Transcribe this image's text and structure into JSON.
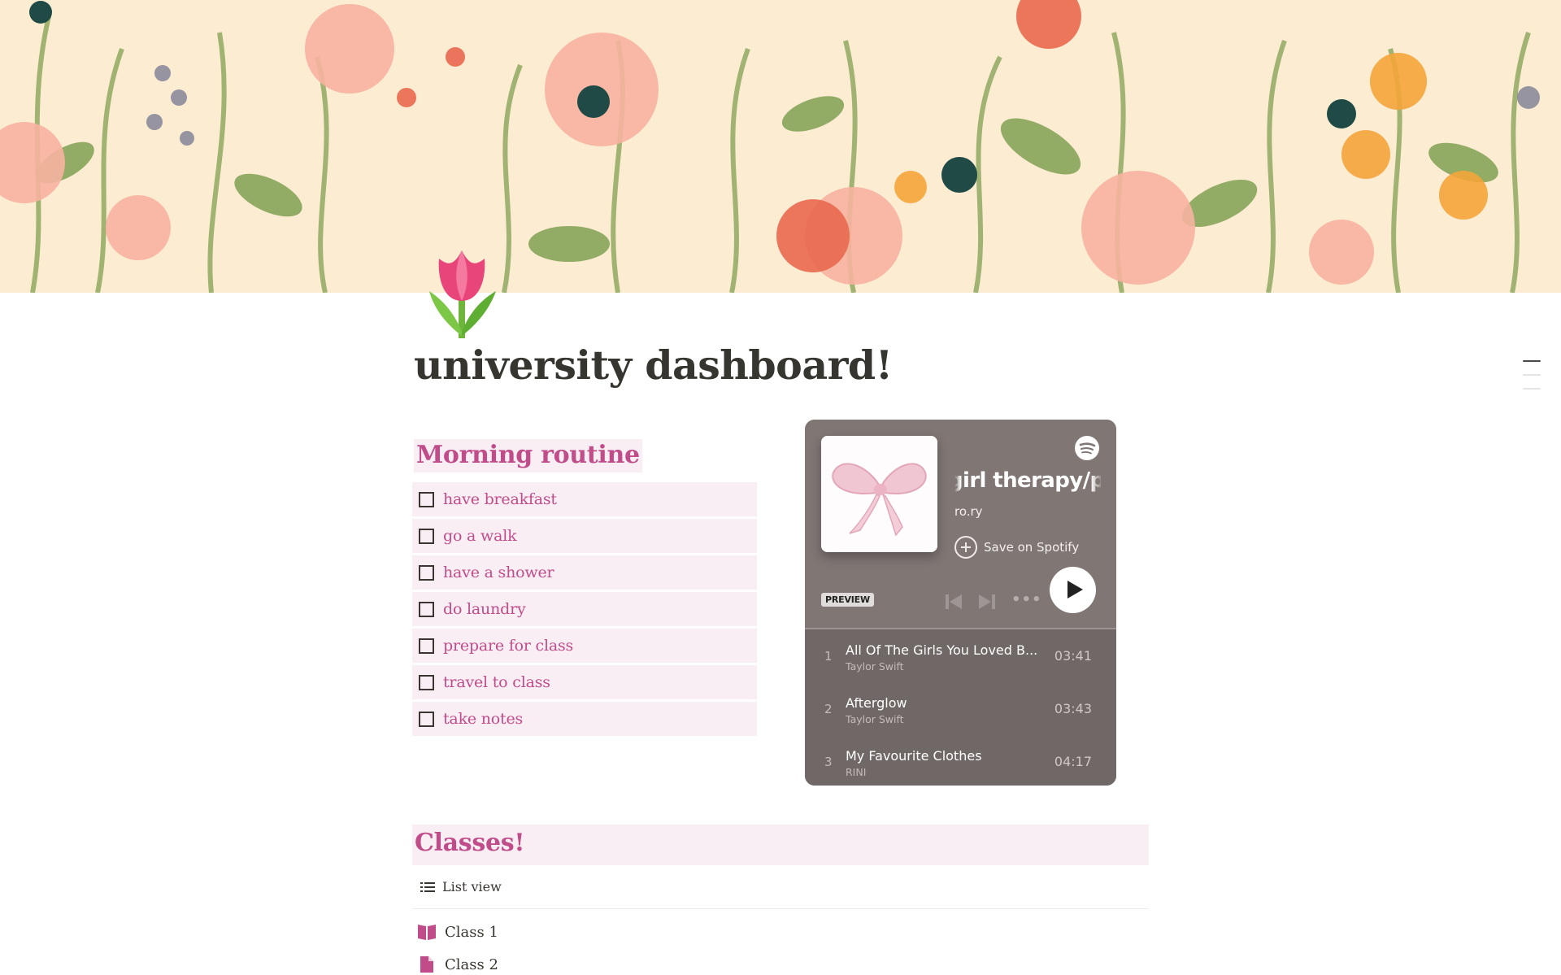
{
  "page": {
    "title": "university dashboard!",
    "icon": "tulip-emoji",
    "cover": "watercolor-wildflowers-cover"
  },
  "toc": {
    "items": [
      "heading-1",
      "heading-2",
      "heading-3"
    ],
    "active_index": 0
  },
  "morning_routine": {
    "heading": "Morning routine",
    "items": [
      {
        "label": "have breakfast",
        "checked": false
      },
      {
        "label": "go a walk",
        "checked": false
      },
      {
        "label": "have a shower",
        "checked": false
      },
      {
        "label": "do laundry",
        "checked": false
      },
      {
        "label": "prepare for class",
        "checked": false
      },
      {
        "label": "travel to class",
        "checked": false
      },
      {
        "label": "take notes",
        "checked": false
      }
    ]
  },
  "spotify": {
    "playlist_title": "girl therapy/pink",
    "playlist_title_visible": "irl therapy/pi",
    "owner": "ro.ry",
    "save_label": "Save on Spotify",
    "preview_badge": "PREVIEW",
    "more_label": "•••",
    "tracks": [
      {
        "num": "1",
        "name": "All Of The Girls You Loved B...",
        "artist": "Taylor Swift",
        "duration": "03:41"
      },
      {
        "num": "2",
        "name": "Afterglow",
        "artist": "Taylor Swift",
        "duration": "03:43"
      },
      {
        "num": "3",
        "name": "My Favourite Clothes",
        "artist": "RINI",
        "duration": "04:17"
      }
    ]
  },
  "classes": {
    "heading": "Classes!",
    "view_label": "List view",
    "items": [
      {
        "label": "Class 1",
        "icon": "book-icon"
      },
      {
        "label": "Class 2",
        "icon": "page-icon"
      }
    ]
  },
  "colors": {
    "accent_pink": "#c14c8a",
    "highlight_bg": "#f9eef3",
    "spotify_bg": "#807775"
  }
}
